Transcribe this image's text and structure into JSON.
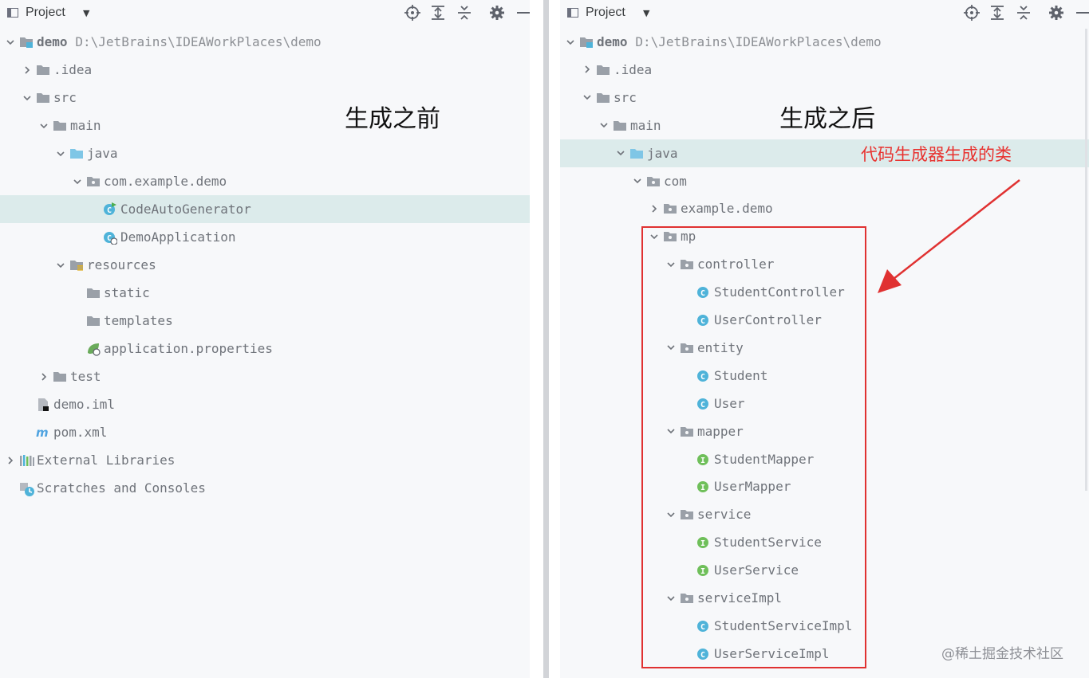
{
  "left": {
    "header_title": "Project",
    "tree": [
      {
        "id": "demo",
        "indent": 0,
        "expanded": true,
        "icon": "module-folder",
        "label": "demo",
        "path": "D:\\JetBrains\\IDEAWorkPlaces\\demo",
        "bold": true
      },
      {
        "id": "idea",
        "indent": 1,
        "expanded": false,
        "icon": "folder",
        "label": ".idea"
      },
      {
        "id": "src",
        "indent": 1,
        "expanded": true,
        "icon": "folder",
        "label": "src"
      },
      {
        "id": "main",
        "indent": 2,
        "expanded": true,
        "icon": "folder",
        "label": "main"
      },
      {
        "id": "java",
        "indent": 3,
        "expanded": true,
        "icon": "source-folder",
        "label": "java"
      },
      {
        "id": "pkg",
        "indent": 4,
        "expanded": true,
        "icon": "package",
        "label": "com.example.demo"
      },
      {
        "id": "codeautogen",
        "indent": 5,
        "icon": "runnable-class",
        "label": "CodeAutoGenerator",
        "selected": true
      },
      {
        "id": "demoapp",
        "indent": 5,
        "icon": "spring-class",
        "label": "DemoApplication"
      },
      {
        "id": "resources",
        "indent": 3,
        "expanded": true,
        "icon": "resources-folder",
        "label": "resources"
      },
      {
        "id": "static",
        "indent": 4,
        "icon": "folder",
        "label": "static"
      },
      {
        "id": "templates",
        "indent": 4,
        "icon": "folder",
        "label": "templates"
      },
      {
        "id": "appprops",
        "indent": 4,
        "icon": "spring-properties",
        "label": "application.properties"
      },
      {
        "id": "test",
        "indent": 2,
        "expanded": false,
        "icon": "folder",
        "label": "test"
      },
      {
        "id": "demoiml",
        "indent": 1,
        "icon": "iml-file",
        "label": "demo.iml"
      },
      {
        "id": "pomxml",
        "indent": 1,
        "icon": "maven",
        "label": "pom.xml"
      },
      {
        "id": "extlibs",
        "indent": 0,
        "expanded": false,
        "icon": "libraries",
        "label": "External Libraries"
      },
      {
        "id": "scratches",
        "indent": 0,
        "icon": "scratches",
        "label": "Scratches and Consoles"
      }
    ]
  },
  "right": {
    "header_title": "Project",
    "tree": [
      {
        "id": "demo",
        "indent": 0,
        "expanded": true,
        "icon": "module-folder",
        "label": "demo",
        "path": "D:\\JetBrains\\IDEAWorkPlaces\\demo",
        "bold": true
      },
      {
        "id": "idea",
        "indent": 1,
        "expanded": false,
        "icon": "folder",
        "label": ".idea"
      },
      {
        "id": "src",
        "indent": 1,
        "expanded": true,
        "icon": "folder",
        "label": "src"
      },
      {
        "id": "main",
        "indent": 2,
        "expanded": true,
        "icon": "folder",
        "label": "main"
      },
      {
        "id": "java",
        "indent": 3,
        "expanded": true,
        "icon": "source-folder",
        "label": "java",
        "selected": true
      },
      {
        "id": "com",
        "indent": 4,
        "expanded": true,
        "icon": "package",
        "label": "com"
      },
      {
        "id": "exampledemo",
        "indent": 5,
        "expanded": false,
        "icon": "package",
        "label": "example.demo"
      },
      {
        "id": "mp",
        "indent": 5,
        "expanded": true,
        "icon": "package",
        "label": "mp"
      },
      {
        "id": "controller",
        "indent": 6,
        "expanded": true,
        "icon": "package",
        "label": "controller"
      },
      {
        "id": "studentcontroller",
        "indent": 7,
        "icon": "class",
        "label": "StudentController"
      },
      {
        "id": "usercontroller",
        "indent": 7,
        "icon": "class",
        "label": "UserController"
      },
      {
        "id": "entity",
        "indent": 6,
        "expanded": true,
        "icon": "package",
        "label": "entity"
      },
      {
        "id": "student",
        "indent": 7,
        "icon": "class",
        "label": "Student"
      },
      {
        "id": "user",
        "indent": 7,
        "icon": "class",
        "label": "User"
      },
      {
        "id": "mapper",
        "indent": 6,
        "expanded": true,
        "icon": "package",
        "label": "mapper"
      },
      {
        "id": "studentmapper",
        "indent": 7,
        "icon": "interface",
        "label": "StudentMapper"
      },
      {
        "id": "usermapper",
        "indent": 7,
        "icon": "interface",
        "label": "UserMapper"
      },
      {
        "id": "service",
        "indent": 6,
        "expanded": true,
        "icon": "package",
        "label": "service"
      },
      {
        "id": "studentservice",
        "indent": 7,
        "icon": "interface",
        "label": "StudentService"
      },
      {
        "id": "userservice",
        "indent": 7,
        "icon": "interface",
        "label": "UserService"
      },
      {
        "id": "serviceimpl",
        "indent": 6,
        "expanded": true,
        "icon": "package",
        "label": "serviceImpl"
      },
      {
        "id": "studentserviceimpl",
        "indent": 7,
        "icon": "class",
        "label": "StudentServiceImpl"
      },
      {
        "id": "userserviceimpl",
        "indent": 7,
        "icon": "class",
        "label": "UserServiceImpl"
      }
    ]
  },
  "annotations": {
    "before": "生成之前",
    "after": "生成之后",
    "generated": "代码生成器生成的类",
    "watermark": "@稀土掘金技术社区"
  },
  "colors": {
    "background": "#f7f8fa",
    "selection": "#dcebeb",
    "text": "#6f737a",
    "annotation_red": "#e8322f",
    "class_icon": "#4fb3d9",
    "interface_icon": "#6fbf5a"
  },
  "icons": {
    "toolbar": [
      "locate-icon",
      "expand-all-icon",
      "collapse-all-icon",
      "settings-icon",
      "hide-icon"
    ]
  }
}
